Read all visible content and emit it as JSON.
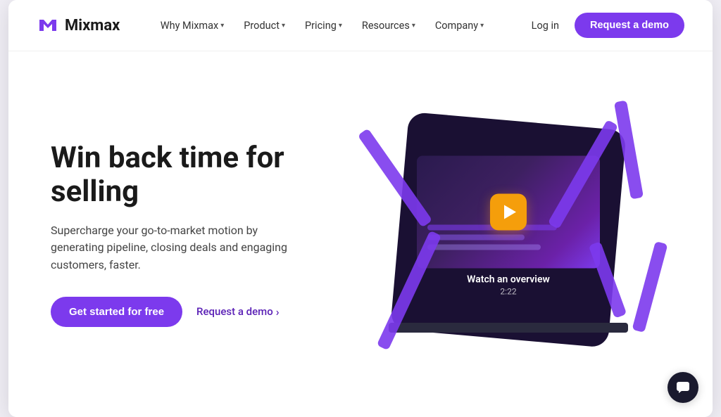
{
  "brand": {
    "logo_text": "Mixmax",
    "logo_color": "#7c3aed"
  },
  "nav": {
    "items": [
      {
        "label": "Why Mixmax",
        "has_dropdown": true
      },
      {
        "label": "Product",
        "has_dropdown": true
      },
      {
        "label": "Pricing",
        "has_dropdown": true
      },
      {
        "label": "Resources",
        "has_dropdown": true
      },
      {
        "label": "Company",
        "has_dropdown": true
      }
    ],
    "login_label": "Log in",
    "demo_label": "Request a demo"
  },
  "hero": {
    "title": "Win back time for selling",
    "subtitle": "Supercharge your go-to-market motion by generating pipeline, closing deals and engaging customers, faster.",
    "cta_primary": "Get started for free",
    "cta_secondary": "Request a demo",
    "cta_secondary_arrow": "›"
  },
  "video": {
    "caption": "Watch an overview",
    "duration": "2:22"
  },
  "chat": {
    "label": "Chat"
  }
}
